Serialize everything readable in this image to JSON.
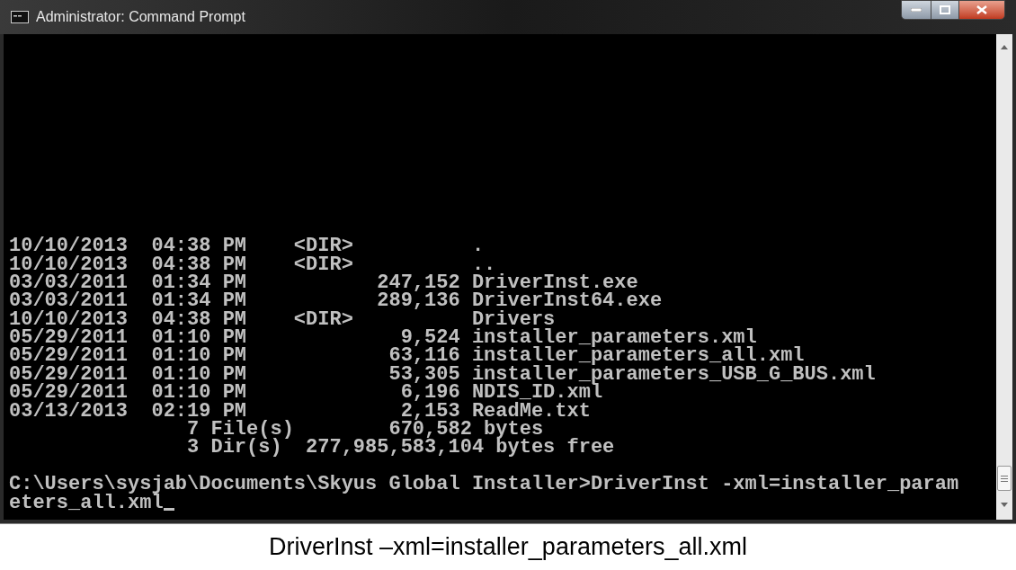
{
  "window": {
    "title": "Administrator: Command Prompt"
  },
  "console": {
    "output_lines": [
      "10/10/2013  04:38 PM    <DIR>          .",
      "10/10/2013  04:38 PM    <DIR>          ..",
      "03/03/2011  01:34 PM           247,152 DriverInst.exe",
      "03/03/2011  01:34 PM           289,136 DriverInst64.exe",
      "10/10/2013  04:38 PM    <DIR>          Drivers",
      "05/29/2011  01:10 PM             9,524 installer_parameters.xml",
      "05/29/2011  01:10 PM            63,116 installer_parameters_all.xml",
      "05/29/2011  01:10 PM            53,305 installer_parameters_USB_G_BUS.xml",
      "05/29/2011  01:10 PM             6,196 NDIS_ID.xml",
      "03/13/2013  02:19 PM             2,153 ReadMe.txt",
      "               7 File(s)        670,582 bytes",
      "               3 Dir(s)  277,985,583,104 bytes free"
    ],
    "prompt_lines": [
      "C:\\Users\\sysjab\\Documents\\Skyus Global Installer>DriverInst -xml=installer_param",
      "eters_all.xml"
    ]
  },
  "caption": "DriverInst –xml=installer_parameters_all.xml"
}
